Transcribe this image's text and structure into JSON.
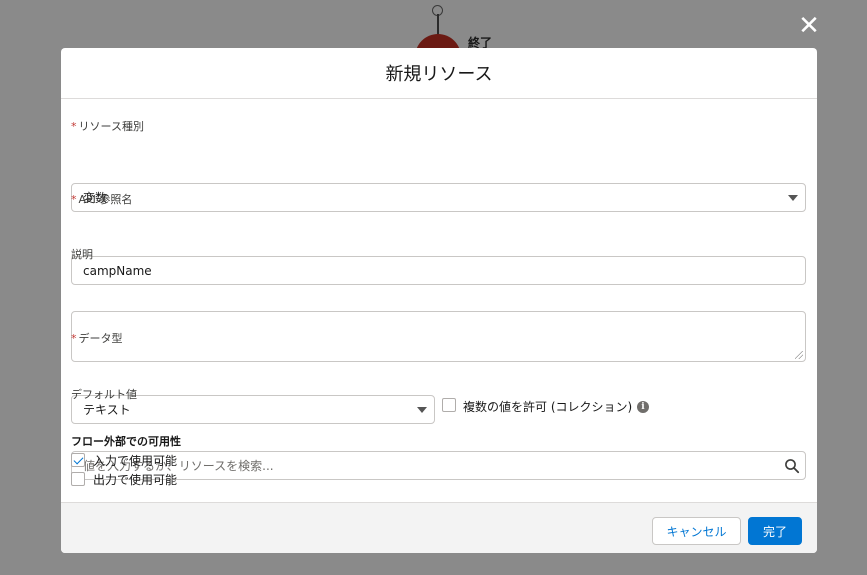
{
  "background": {
    "end_node_label": "終了"
  },
  "dialog": {
    "title": "新規リソース",
    "close_icon": "close-icon"
  },
  "fields": {
    "resource_type": {
      "label": "リソース種別",
      "required": true,
      "value": "変数"
    },
    "api_name": {
      "label": "API 参照名",
      "required": true,
      "value": "campName"
    },
    "description": {
      "label": "説明",
      "value": ""
    },
    "data_type": {
      "label": "データ型",
      "required": true,
      "value": "テキスト"
    },
    "allow_multiple": {
      "label": "複数の値を許可 (コレクション)",
      "checked": false,
      "info_icon": "info-icon"
    },
    "default_value": {
      "label": "デフォルト値",
      "placeholder": "値を入力するか、リソースを検索...",
      "icon": "search-icon"
    }
  },
  "availability": {
    "heading": "フロー外部での可用性",
    "options": [
      {
        "label": "入力で使用可能",
        "checked": true
      },
      {
        "label": "出力で使用可能",
        "checked": false
      }
    ]
  },
  "footer": {
    "cancel_label": "キャンセル",
    "done_label": "完了"
  },
  "colors": {
    "brand": "#0176d3",
    "required": "#c23934",
    "overlay": "#8a8a8a",
    "end_node": "#6b1a13"
  }
}
